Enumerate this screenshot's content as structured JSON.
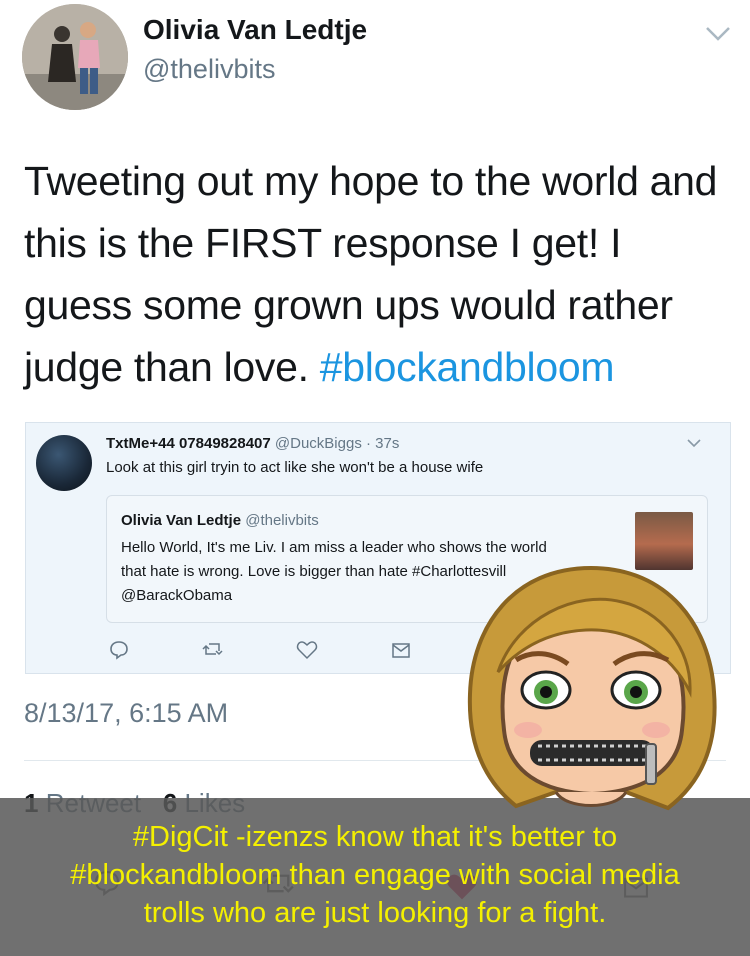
{
  "tweet": {
    "author_name": "Olivia Van Ledtje",
    "author_handle": "@thelivbits",
    "text_main": "Tweeting out my hope to the world and this is the FIRST response I get! I guess some grown ups would rather judge than love.",
    "hashtag": "#blockandbloom",
    "timestamp": "8/13/17, 6:15 AM",
    "retweets_count": "1",
    "retweets_label": "Retweet",
    "likes_count": "6",
    "likes_label": "Likes"
  },
  "embedded": {
    "reply_name": "TxtMe+44 07849828407",
    "reply_handle": "@DuckBiggs",
    "reply_time": "· 37s",
    "reply_text": "Look at this girl tryin to act like she won't be a house wife",
    "quoted_name": "Olivia Van Ledtje",
    "quoted_handle": "@thelivbits",
    "quoted_line1": "Hello World, It's me Liv. I am miss a leader who shows the world",
    "quoted_line2": "that hate is wrong. Love is bigger than hate #Charlottesvill",
    "quoted_line3": "@BarackObama"
  },
  "caption": {
    "line1": "#DigCit -izenzs know that it's better to",
    "line2": "#blockandbloom than engage with social media",
    "line3": "trolls who are just looking for a fight."
  },
  "colors": {
    "link_blue": "#1b95e0",
    "caption_yellow": "#f4f000",
    "muted_gray": "#657786",
    "like_red": "#e0245e"
  }
}
